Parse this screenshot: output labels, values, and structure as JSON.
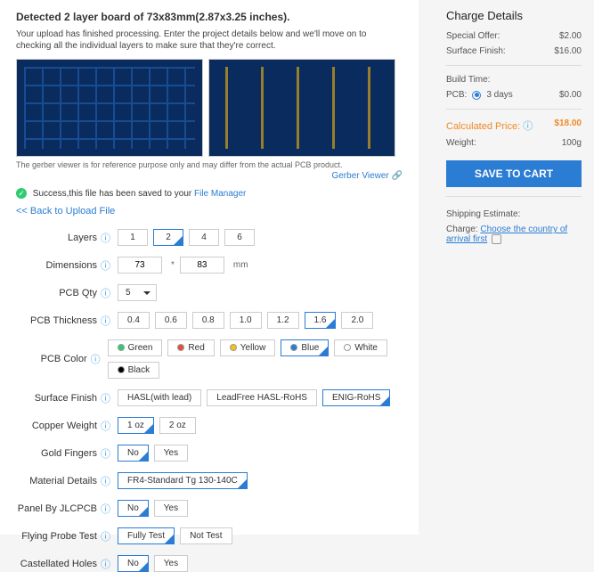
{
  "title": "Detected 2 layer board of 73x83mm(2.87x3.25 inches).",
  "desc": "Your upload has finished processing. Enter the project details below and we'll move on to checking all the individual layers to make sure that they're correct.",
  "gerber_note": "The gerber viewer is for reference purpose only and may differ from the actual PCB product.",
  "gerber_link": "Gerber Viewer",
  "success_prefix": "Success,this file has been saved to your",
  "success_link": "File Manager",
  "back": "<< Back to Upload File",
  "form": {
    "layers": {
      "label": "Layers",
      "opts": [
        "1",
        "2",
        "4",
        "6"
      ],
      "sel": 1
    },
    "dimensions": {
      "label": "Dimensions",
      "w": "73",
      "h": "83",
      "x": "*",
      "unit": "mm"
    },
    "qty": {
      "label": "PCB Qty",
      "val": "5"
    },
    "thickness": {
      "label": "PCB Thickness",
      "opts": [
        "0.4",
        "0.6",
        "0.8",
        "1.0",
        "1.2",
        "1.6",
        "2.0"
      ],
      "sel": 5
    },
    "color": {
      "label": "PCB Color",
      "opts": [
        {
          "t": "Green",
          "c": "#2ecc71"
        },
        {
          "t": "Red",
          "c": "#e74c3c"
        },
        {
          "t": "Yellow",
          "c": "#f1c40f"
        },
        {
          "t": "Blue",
          "c": "#2b7cd3"
        },
        {
          "t": "White",
          "c": "#fff"
        },
        {
          "t": "Black",
          "c": "#000"
        }
      ],
      "sel": 3
    },
    "finish": {
      "label": "Surface Finish",
      "opts": [
        "HASL(with lead)",
        "LeadFree HASL-RoHS",
        "ENIG-RoHS"
      ],
      "sel": 2
    },
    "copper": {
      "label": "Copper Weight",
      "opts": [
        "1 oz",
        "2 oz"
      ],
      "sel": 0
    },
    "gold": {
      "label": "Gold Fingers",
      "opts": [
        "No",
        "Yes"
      ],
      "sel": 0
    },
    "material": {
      "label": "Material Details",
      "opts": [
        "FR4-Standard Tg 130-140C"
      ],
      "sel": 0
    },
    "panel": {
      "label": "Panel By JLCPCB",
      "opts": [
        "No",
        "Yes"
      ],
      "sel": 0
    },
    "probe": {
      "label": "Flying Probe Test",
      "opts": [
        "Fully Test",
        "Not Test"
      ],
      "sel": 0
    },
    "cast": {
      "label": "Castellated Holes",
      "opts": [
        "No",
        "Yes"
      ],
      "sel": 0
    }
  },
  "charge": {
    "heading": "Charge Details",
    "special": {
      "l": "Special Offer:",
      "v": "$2.00"
    },
    "surface": {
      "l": "Surface Finish:",
      "v": "$16.00"
    },
    "build": "Build Time:",
    "pcb": {
      "l": "PCB:",
      "opt": "3 days",
      "v": "$0.00"
    },
    "calc": {
      "l": "Calculated Price:",
      "v": "$18.00"
    },
    "weight": {
      "l": "Weight:",
      "v": "100g"
    },
    "save": "SAVE TO CART",
    "ship_head": "Shipping Estimate:",
    "ship_l": "Charge:",
    "ship_link": "Choose the country of arrival first"
  }
}
